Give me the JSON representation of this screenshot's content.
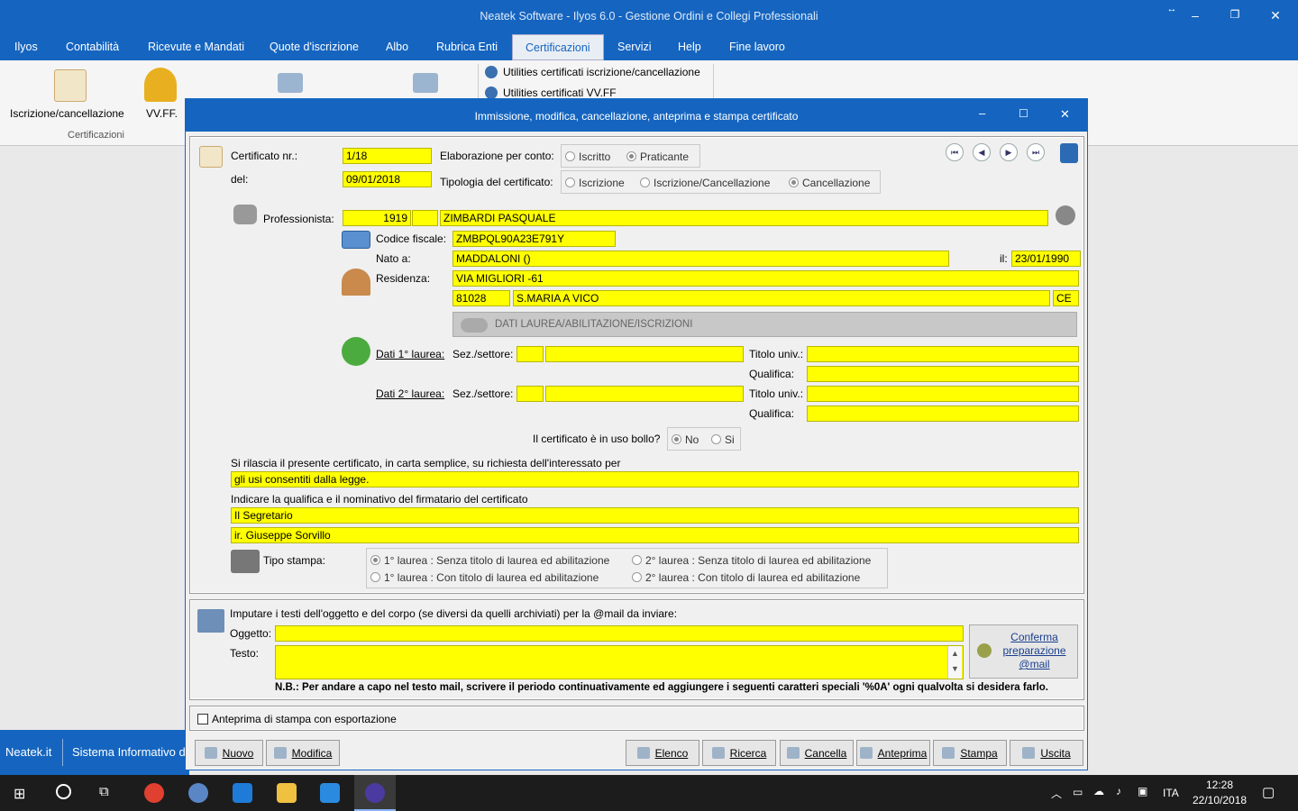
{
  "window": {
    "title": "Neatek Software - Ilyos 6.0 - Gestione Ordini e Collegi Professionali"
  },
  "menu": {
    "items": [
      "Ilyos",
      "Contabilità",
      "Ricevute e Mandati",
      "Quote d'iscrizione",
      "Albo",
      "Rubrica Enti",
      "Certificazioni",
      "Servizi",
      "Help",
      "Fine lavoro"
    ],
    "active": "Certificazioni"
  },
  "ribbon": {
    "btn1": "Iscrizione/cancellazione",
    "btn2": "VV.FF.",
    "group": "Certificazioni",
    "util1": "Utilities certificati iscrizione/cancellazione",
    "util2": "Utilities certificati VV.FF"
  },
  "statusbar": {
    "left": "Neatek.it",
    "mid": "Sistema Informativo d"
  },
  "dialog": {
    "title": "Immissione, modifica, cancellazione, anteprima e stampa certificato",
    "cert": {
      "nr_label": "Certificato nr.:",
      "nr": "1/18",
      "del_label": "del:",
      "del": "09/01/2018",
      "conto_label": "Elaborazione per conto:",
      "conto_opts": [
        "Iscritto",
        "Praticante"
      ],
      "tipo_label": "Tipologia del certificato:",
      "tipo_opts": [
        "Iscrizione",
        "Iscrizione/Cancellazione",
        "Cancellazione"
      ]
    },
    "prof": {
      "label": "Professionista:",
      "code": "1919",
      "code2": "",
      "name": "ZIMBARDI PASQUALE",
      "cf_label": "Codice fiscale:",
      "cf": "ZMBPQL90A23E791Y",
      "nato_label": "Nato a:",
      "nato": "MADDALONI ()",
      "il_label": "il:",
      "il": "23/01/1990",
      "res_label": "Residenza:",
      "via": "VIA MIGLIORI -61",
      "cap": "81028",
      "citta": "S.MARIA A VICO",
      "prov": "CE"
    },
    "banner": "DATI LAUREA/ABILITAZIONE/ISCRIZIONI",
    "laurea": {
      "dati1": "Dati 1° laurea:",
      "dati2": "Dati 2° laurea:",
      "sez": "Sez./settore:",
      "titolo": "Titolo univ.:",
      "qualifica": "Qualifica:"
    },
    "bollo": {
      "label": "Il certificato è in uso bollo?",
      "opts": [
        "No",
        "Si"
      ]
    },
    "rilascia": {
      "label": "Si rilascia il presente certificato, in carta semplice, su richiesta dell'interessato per",
      "value": "gli usi consentiti dalla legge."
    },
    "firmatario": {
      "label": "Indicare la qualifica e il nominativo del firmatario del certificato",
      "qualifica": "Il Segretario",
      "nome": "ir. Giuseppe Sorvillo"
    },
    "stampa": {
      "label": "Tipo stampa:",
      "opts": [
        "1° laurea : Senza titolo di laurea ed abilitazione",
        "2° laurea : Senza titolo di laurea ed abilitazione",
        "1° laurea : Con titolo di laurea ed abilitazione",
        "2° laurea : Con titolo di laurea ed abilitazione"
      ]
    },
    "mail": {
      "intro": "Imputare i testi dell'oggetto e del corpo (se diversi da quelli archiviati) per la @mail da inviare:",
      "oggetto_label": "Oggetto:",
      "oggetto": "",
      "testo_label": "Testo:",
      "testo": "",
      "note": "N.B.: Per andare a capo nel testo mail, scrivere il periodo continuativamente ed aggiungere i seguenti caratteri speciali  '%0A'  ogni qualvolta si desidera farlo.",
      "confirm": "Conferma preparazione @mail"
    },
    "anteprima": "Anteprima di stampa con esportazione",
    "buttons": [
      "Nuovo",
      "Modifica",
      "Elenco",
      "Ricerca",
      "Cancella",
      "Anteprima",
      "Stampa",
      "Uscita"
    ]
  },
  "taskbar": {
    "lang": "ITA",
    "time": "12:28",
    "date": "22/10/2018"
  }
}
